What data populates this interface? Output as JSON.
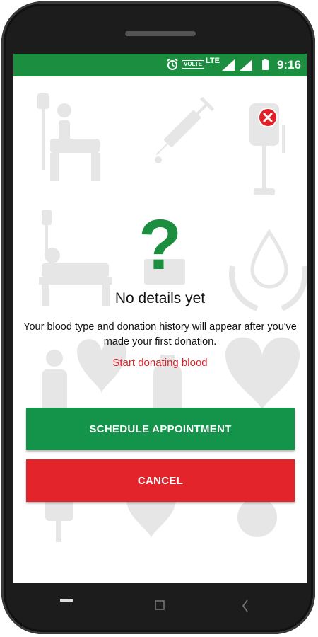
{
  "status_bar": {
    "time": "9:16",
    "volte_label": "VOLTE",
    "network_label": "LTE",
    "icons": [
      "alarm-icon",
      "volte-icon",
      "lte-icon",
      "signal-icon",
      "signal-icon",
      "battery-icon"
    ]
  },
  "dialog": {
    "close_icon": "close-icon",
    "question_icon": "?",
    "title": "No details yet",
    "description": "Your blood type and donation history will appear after you've made your first donation.",
    "link_text": "Start donating blood"
  },
  "actions": {
    "schedule_label": "SCHEDULE APPOINTMENT",
    "cancel_label": "CANCEL"
  },
  "nav_bar": {
    "icons": [
      "menu-icon",
      "home-icon",
      "back-icon"
    ]
  },
  "colors": {
    "brand_green": "#1b8f3f",
    "button_green": "#14934a",
    "accent_red": "#e3242b",
    "background_art": "#e6e6e6"
  }
}
